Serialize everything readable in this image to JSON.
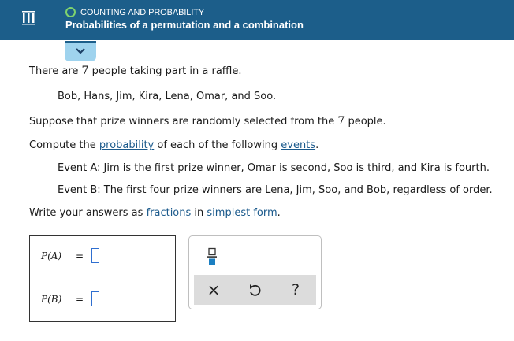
{
  "header": {
    "topic": "COUNTING AND PROBABILITY",
    "title": "Probabilities of a permutation and a combination",
    "colors": {
      "bar": "#1c5e8a",
      "topic_ring": "#7fd36e",
      "tab": "#9fd3ee"
    },
    "icons": {
      "menu": "menu-icon",
      "collapse": "chevron-down-icon"
    }
  },
  "problem": {
    "intro_a": "There are ",
    "intro_num": "7",
    "intro_b": " people taking part in a raffle.",
    "names": "Bob, Hans, Jim, Kira, Lena, Omar, and Soo.",
    "suppose_a": "Suppose that prize winners are randomly selected from the ",
    "suppose_num": "7",
    "suppose_b": " people.",
    "compute_a": "Compute the ",
    "compute_link1": "probability",
    "compute_b": " of each of the following ",
    "compute_link2": "events",
    "compute_c": ".",
    "event_a": "Event A: Jim is the first prize winner, Omar is second, Soo is third, and Kira is fourth.",
    "event_b": "Event B: The first four prize winners are Lena, Jim, Soo, and Bob, regardless of order.",
    "write_a": "Write your answers as ",
    "write_link1": "fractions",
    "write_b": " in ",
    "write_link2": "simplest form",
    "write_c": "."
  },
  "answers": {
    "pa_label": "P(A)",
    "pb_label": "P(B)",
    "equals": "=",
    "pa_value": "",
    "pb_value": ""
  },
  "tools": {
    "icons": [
      "fraction-icon",
      "clear-icon",
      "undo-icon",
      "help-icon"
    ],
    "clear": "×",
    "help": "?"
  }
}
